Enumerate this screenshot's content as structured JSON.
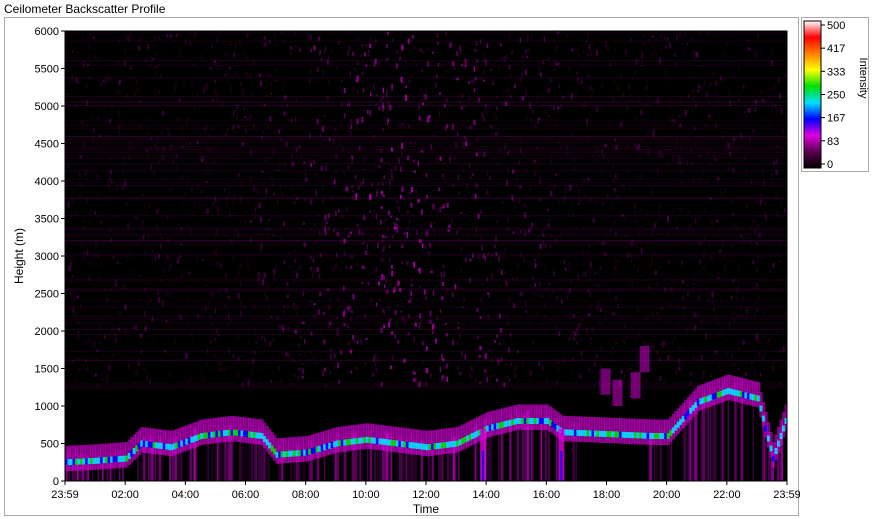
{
  "window": {
    "title": "Ceilometer Backscatter Profile"
  },
  "colors": {
    "background": "#000000",
    "low_signal": "#5a004f",
    "magenta": "#e000e0",
    "blue": "#0000ff",
    "cyan": "#00e0ff",
    "green": "#00e000",
    "yellow": "#ffff00",
    "orange": "#ff8000",
    "red": "#ff0000"
  },
  "chart_data": {
    "type": "heatmap",
    "title": "Ceilometer Backscatter Profile",
    "xlabel": "Time",
    "ylabel": "Height (m)",
    "x_ticks": [
      "23:59",
      "02:00",
      "04:00",
      "06:00",
      "08:00",
      "10:00",
      "12:00",
      "14:00",
      "16:00",
      "18:00",
      "20:00",
      "22:00",
      "23:59"
    ],
    "x_tick_hours": [
      0,
      2,
      4,
      6,
      8,
      10,
      12,
      14,
      16,
      18,
      20,
      22,
      24
    ],
    "xlim_hours": [
      0,
      24
    ],
    "y_ticks": [
      0,
      500,
      1000,
      1500,
      2000,
      2500,
      3000,
      3500,
      4000,
      4500,
      5000,
      5500,
      6000
    ],
    "ylim": [
      0,
      6000
    ],
    "colorbar": {
      "label": "Intensity",
      "ticks": [
        "500",
        "417",
        "333",
        "250",
        "167",
        "83",
        "0"
      ],
      "range": [
        0,
        500
      ],
      "stops": [
        "#000000",
        "#5a004f",
        "#e000e0",
        "#0000ff",
        "#00e0ff",
        "#00e000",
        "#ffff00",
        "#ff8000",
        "#ff0000",
        "#ffffff"
      ]
    },
    "cloud_layer": {
      "description_hours_height": [
        [
          0.0,
          250
        ],
        [
          1.0,
          270
        ],
        [
          2.0,
          300
        ],
        [
          2.5,
          500
        ],
        [
          3.5,
          450
        ],
        [
          4.5,
          600
        ],
        [
          5.5,
          650
        ],
        [
          6.5,
          600
        ],
        [
          7.0,
          350
        ],
        [
          8.0,
          380
        ],
        [
          9.0,
          500
        ],
        [
          10.0,
          550
        ],
        [
          11.0,
          500
        ],
        [
          12.0,
          450
        ],
        [
          13.0,
          500
        ],
        [
          14.0,
          700
        ],
        [
          15.0,
          800
        ],
        [
          16.0,
          800
        ],
        [
          16.5,
          650
        ],
        [
          19.5,
          600
        ],
        [
          20.0,
          600
        ],
        [
          21.0,
          1050
        ],
        [
          22.0,
          1200
        ],
        [
          23.0,
          1100
        ],
        [
          23.5,
          300
        ],
        [
          24.0,
          900
        ]
      ]
    }
  }
}
